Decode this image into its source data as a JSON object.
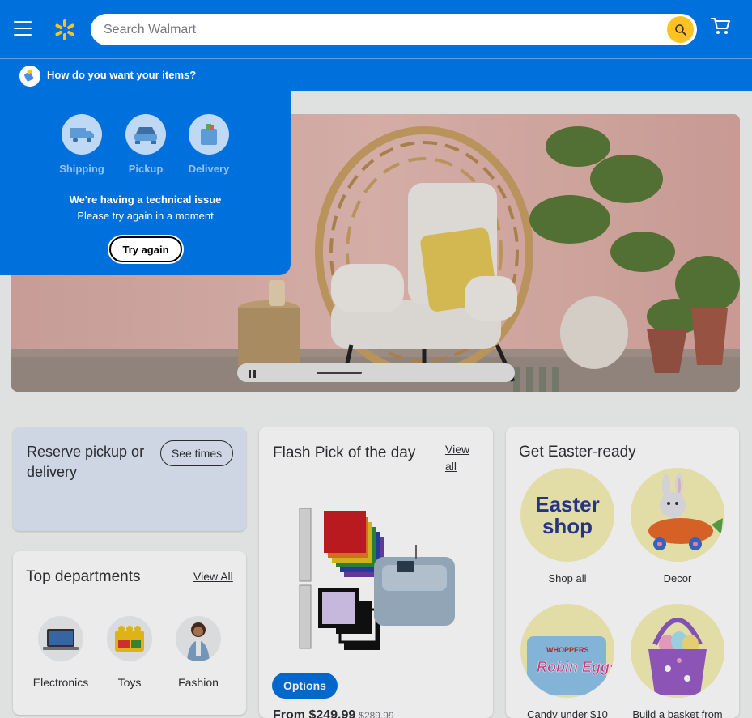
{
  "header": {
    "search_placeholder": "Search Walmart",
    "brand_color": "#0071dc",
    "accent_color": "#ffc220",
    "icons": [
      "menu-icon",
      "spark-logo",
      "search-icon",
      "cart-icon"
    ]
  },
  "fulfillment": {
    "question": "How do you want your items?",
    "options": [
      {
        "label": "Shipping",
        "icon": "truck-icon"
      },
      {
        "label": "Pickup",
        "icon": "car-icon"
      },
      {
        "label": "Delivery",
        "icon": "bag-icon"
      }
    ],
    "error_title": "We're having a technical issue",
    "error_message": "Please try again in a moment",
    "retry_label": "Try again"
  },
  "reserve": {
    "title": "Reserve pickup or delivery",
    "button": "See times"
  },
  "top_departments": {
    "title": "Top departments",
    "view_all": "View All",
    "items": [
      {
        "label": "Electronics"
      },
      {
        "label": "Toys"
      },
      {
        "label": "Fashion"
      }
    ]
  },
  "flash_pick": {
    "title": "Flash Pick of the day",
    "view_all": "View all",
    "button": "Options",
    "price": "From $249.99",
    "was_price": "$289.99"
  },
  "easter": {
    "title": "Get Easter-ready",
    "tiles": [
      {
        "label": "Shop all",
        "circle_text_1": "Easter",
        "circle_text_2": "shop"
      },
      {
        "label": "Decor"
      },
      {
        "label": "Candy under $10",
        "pack_brand": "WHOPPERS",
        "pack_name": "Robin Eggs"
      },
      {
        "label": "Build a basket from"
      }
    ]
  }
}
